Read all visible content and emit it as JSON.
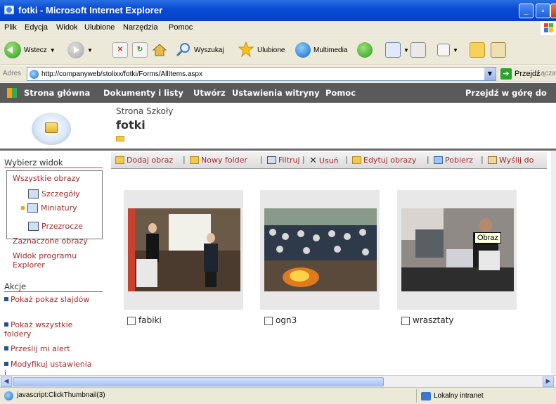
{
  "window": {
    "title": "fotki - Microsoft Internet Explorer"
  },
  "menu": [
    "Plik",
    "Edycja",
    "Widok",
    "Ulubione",
    "Narzędzia",
    "Pomoc"
  ],
  "toolbar": {
    "back_label": "Wstecz",
    "search_label": "Wyszukaj",
    "favorites_label": "Ulubione",
    "media_label": "Multimedia"
  },
  "address": {
    "label": "Adres",
    "url": "http://companyweb/stolixx/fotki/Forms/AllItems.aspx",
    "go_label": "Przejdź",
    "links_label": "Łącza"
  },
  "spnav": {
    "items": [
      "Strona główna",
      "Dokumenty i listy",
      "Utwórz",
      "Ustawienia witryny",
      "Pomoc"
    ],
    "up_label": "Przejdź w górę do"
  },
  "header": {
    "site_name": "Strona Szkoły",
    "page_title": "fotki"
  },
  "leftnav": {
    "views_header": "Wybierz widok",
    "views": [
      "Wszystkie obrazy",
      "Szczegóły",
      "Miniatury",
      "Przezrocze"
    ],
    "selected_images": "Zaznaczone obrazy",
    "explorer_view": "Widok programu Explorer",
    "actions_header": "Akcje",
    "actions": [
      "Pokaż pokaz slajdów",
      "Pokaż wszystkie foldery",
      "Prześlij mi alert",
      "Modyfikuj ustawienia i"
    ]
  },
  "actions_toolbar": [
    "Dodaj obraz",
    "Nowy folder",
    "Filtruj",
    "Usuń",
    "Edytuj obrazy",
    "Pobierz",
    "Wyślij do"
  ],
  "thumbnails": [
    {
      "name": "fabiki"
    },
    {
      "name": "ogn3"
    },
    {
      "name": "wrasztaty"
    }
  ],
  "tooltip": "Obraz",
  "status": {
    "text": "javascript:ClickThumbnail(3)",
    "zone": "Lokalny intranet"
  }
}
